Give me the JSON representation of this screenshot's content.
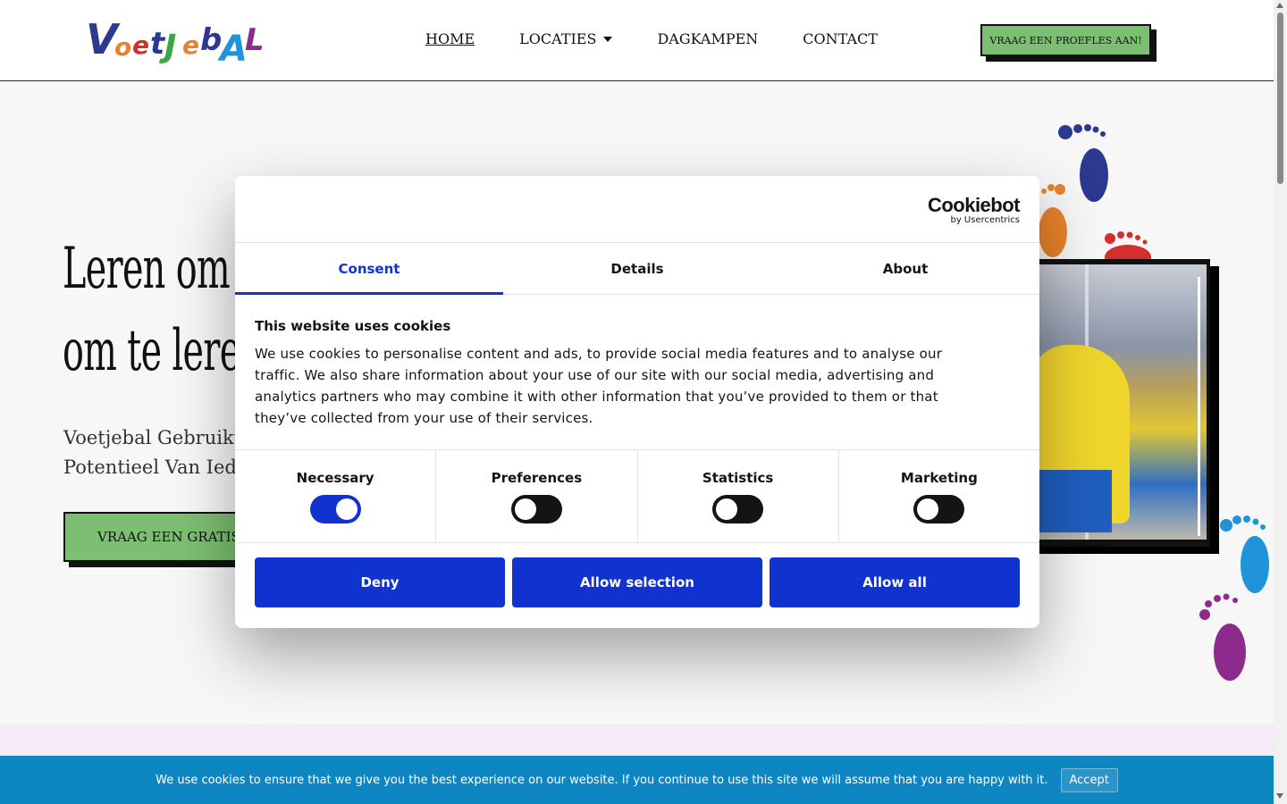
{
  "header": {
    "nav": [
      {
        "label": "HOME"
      },
      {
        "label": "LOCATIES"
      },
      {
        "label": "DAGKAMPEN"
      },
      {
        "label": "CONTACT"
      }
    ],
    "cta_label": "VRAAG EEN PROEFLES AAN!"
  },
  "hero": {
    "title_line1": "Leren om",
    "title_line2": "om te lere",
    "subtitle_line1": "Voetjebal Gebruikt",
    "subtitle_line2": "Potentieel Van Iede",
    "button_label": "VRAAG EEN GRATIS"
  },
  "dialog": {
    "tabs": [
      "Consent",
      "Details",
      "About"
    ],
    "active_tab": "Consent",
    "brand_name": "Cookiebot",
    "brand_by": "by Usercentrics",
    "title": "This website uses cookies",
    "text_line1": "We use cookies to personalise content and ads, to provide social media features and to analyse our",
    "text_line2": "traffic. We also share information about your use of our site with our social media, advertising and",
    "text_line3": "analytics partners who may combine it with other information that you’ve provided to them or that",
    "text_line4": "they’ve collected from your use of their services.",
    "toggles": [
      {
        "label": "Necessary",
        "on": true
      },
      {
        "label": "Preferences",
        "on": false
      },
      {
        "label": "Statistics",
        "on": false
      },
      {
        "label": "Marketing",
        "on": false
      }
    ],
    "buttons": {
      "deny": "Deny",
      "allow_selection": "Allow selection",
      "allow_all": "Allow all"
    },
    "accent_color": "#1032cf"
  },
  "notice": {
    "text": "We use cookies to ensure that we give you the best experience on our website. If you continue to use this site we will assume that you are happy with it.",
    "accept_label": "Accept",
    "color": "#0e86c1"
  },
  "logo": {
    "letters": [
      "V",
      "o",
      "e",
      "t",
      "j",
      "e",
      "b",
      "A",
      "L"
    ],
    "colors": [
      "#2b3a8f",
      "#e9822b",
      "#d52e2e",
      "#2b3a8f",
      "#3aa645",
      "#e9822b",
      "#2b3a8f",
      "#2094d8",
      "#8c2b8c"
    ]
  }
}
